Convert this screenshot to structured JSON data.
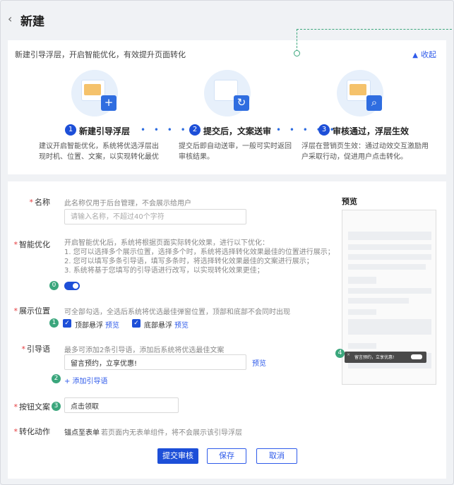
{
  "header": {
    "title": "新建"
  },
  "intro": {
    "text": "新建引导浮层，开启智能优化，有效提升页面转化",
    "collapse_label": "收起"
  },
  "steps": [
    {
      "num": "1",
      "title": "新建引导浮层",
      "desc": "建议开启智能优化，系统将优选浮层出现时机、位置、文案，以实现转化最优",
      "badge_icon": "plus-icon"
    },
    {
      "num": "2",
      "title": "提交后，文案送审",
      "desc": "提交后即自动送审，一般可实时返回审核结果。",
      "badge_icon": "refresh-icon"
    },
    {
      "num": "3",
      "title": "审核通过，浮层生效",
      "desc": "浮层在营销页生效：通过动效交互激励用户采取行动，促进用户点击转化。",
      "badge_icon": "search-icon"
    }
  ],
  "step_dots": "• • • • •",
  "form": {
    "name": {
      "label": "名称",
      "hint": "此名称仅用于后台管理，不会展示给用户",
      "placeholder": "请输入名称，不超过40个字符"
    },
    "smart": {
      "label": "智能优化",
      "hints": [
        "开启智能优化后，系统将根据页面实际转化效果，进行以下优化：",
        "1. 您可以选择多个展示位置，选择多个时，系统将选择转化效果最佳的位置进行展示；",
        "2. 您可以填写多条引导语，填写多条时，将选择转化效果最佳的文案进行展示；",
        "3. 系统将基于您填写的引导语进行改写，以实现转化效果更佳；"
      ],
      "annot": "0"
    },
    "position": {
      "label": "展示位置",
      "hint": "可全部勾选，全选后系统将优选最佳弹窗位置，顶部和底部不会同时出现",
      "options": [
        {
          "label": "顶部悬浮",
          "link": "预览"
        },
        {
          "label": "底部悬浮",
          "link": "预览"
        }
      ],
      "annot": "1"
    },
    "guide": {
      "label": "引导语",
      "hint": "最多可添加2条引导语，添加后系统将优选最佳文案",
      "value": "留言预约，立享优惠!",
      "preview_link": "预览",
      "add_link": "+ 添加引导语",
      "annot": "2"
    },
    "button_text": {
      "label": "按钮文案",
      "value": "点击领取",
      "annot": "3"
    },
    "action": {
      "label": "转化动作",
      "value": "锚点至表单",
      "hint": "若页面内无表单组件，将不会展示该引导浮层"
    },
    "buttons": {
      "submit": "提交审核",
      "save": "保存",
      "cancel": "取消"
    }
  },
  "preview": {
    "title": "预览",
    "toast_text": "留言预约，立享优惠!",
    "annot": "4"
  },
  "colors": {
    "primary": "#1d4fd8",
    "annotation": "#3aa67c",
    "required": "#e4393c",
    "illustration_bg": "#e7f0fb"
  }
}
